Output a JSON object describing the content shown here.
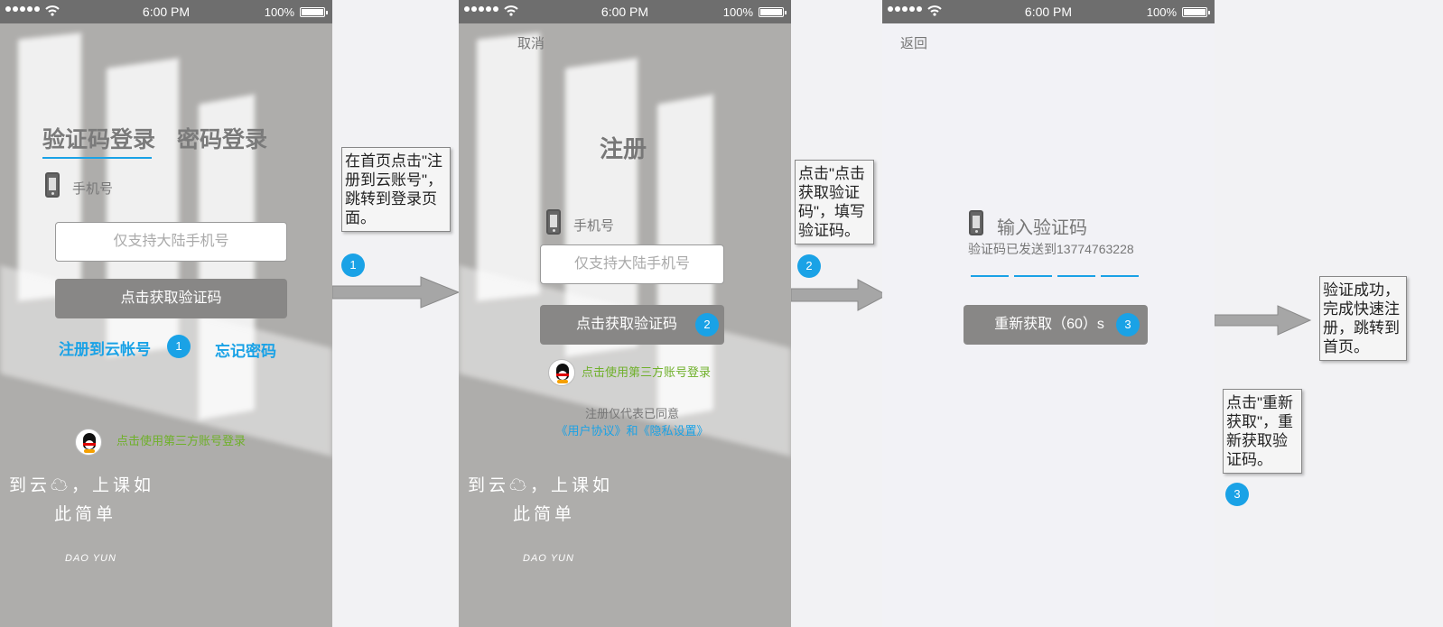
{
  "status_bar": {
    "time": "6:00 PM",
    "battery": "100%"
  },
  "screen1": {
    "tab_code": "验证码登录",
    "tab_password": "密码登录",
    "phone_label": "手机号",
    "phone_placeholder": "仅支持大陆手机号",
    "get_code": "点击获取验证码",
    "register": "注册到云帐号",
    "forgot": "忘记密码",
    "third_party": "点击使用第三方账号登录",
    "slogan_line1": "到云☁，上课如",
    "slogan_line2": "此简单",
    "brand": "DAO YUN"
  },
  "screen2": {
    "cancel": "取消",
    "title": "注册",
    "phone_label": "手机号",
    "phone_placeholder": "仅支持大陆手机号",
    "get_code": "点击获取验证码",
    "third_party": "点击使用第三方账号登录",
    "agree_line": "注册仅代表已同意",
    "agree_links": "《用户协议》和《隐私设置》",
    "slogan_line1": "到云☁，上课如",
    "slogan_line2": "此简单",
    "brand": "DAO YUN"
  },
  "screen3": {
    "back": "返回",
    "input_code": "输入验证码",
    "sent_to": "验证码已发送到13774763228",
    "resend": "重新获取（60）s"
  },
  "badges": {
    "one": "1",
    "two": "2",
    "three": "3"
  },
  "notes": {
    "n1": "在首页点击\"注册到云账号\"，跳转到登录页面。",
    "n2": "点击\"点击获取验证码\"，填写验证码。",
    "n3": "点击\"重新获取\"，重新获取验证码。",
    "n4": "验证成功，完成快速注册，跳转到首页。"
  },
  "colors": {
    "accent": "#1aa2e6",
    "button": "#888786",
    "third_party": "#6fb02a"
  },
  "icons": [
    "signal-icon",
    "wifi-icon",
    "battery-icon",
    "phone-icon",
    "qq-penguin-icon",
    "right-arrow-icon"
  ]
}
